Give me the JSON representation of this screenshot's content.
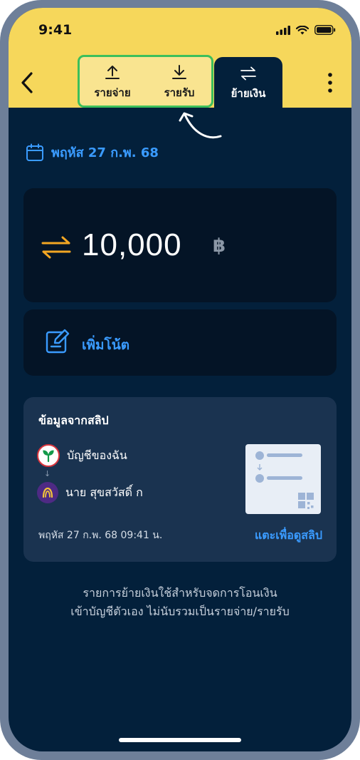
{
  "status_bar": {
    "time": "9:41"
  },
  "tabs": {
    "expense_label": "รายจ่าย",
    "income_label": "รายรับ",
    "transfer_label": "ย้ายเงิน"
  },
  "transaction": {
    "date": "พฤหัส 27 ก.พ. 68",
    "amount": "10,000",
    "currency_symbol": "฿",
    "add_note_label": "เพิ่มโน้ต"
  },
  "slip": {
    "title": "ข้อมูลจากสลิป",
    "from_account": "บัญชีของฉัน",
    "to_account": "นาย สุขสวัสดิ์ ก",
    "datetime": "พฤหัส 27 ก.พ. 68  09:41 น.",
    "view_slip_label": "แตะเพื่อดูสลิป"
  },
  "info": {
    "line1": "รายการย้ายเงินใช้สำหรับจดการโอนเงิน",
    "line2": "เข้าบัญชีตัวเอง ไม่นับรวมเป็นรายจ่าย/รายรับ"
  },
  "colors": {
    "header_bg": "#f6d75b",
    "screen_bg": "#03203b",
    "accent_blue": "#3a9bff",
    "highlight_green": "#3cbf5b"
  },
  "icons": [
    "signal-icon",
    "wifi-icon",
    "battery-icon",
    "back-arrow-icon",
    "upload-icon",
    "download-icon",
    "transfer-icon",
    "more-vertical-icon",
    "calendar-icon",
    "exchange-icon",
    "note-edit-icon",
    "kbank-logo",
    "scb-logo",
    "qr-code-icon"
  ]
}
